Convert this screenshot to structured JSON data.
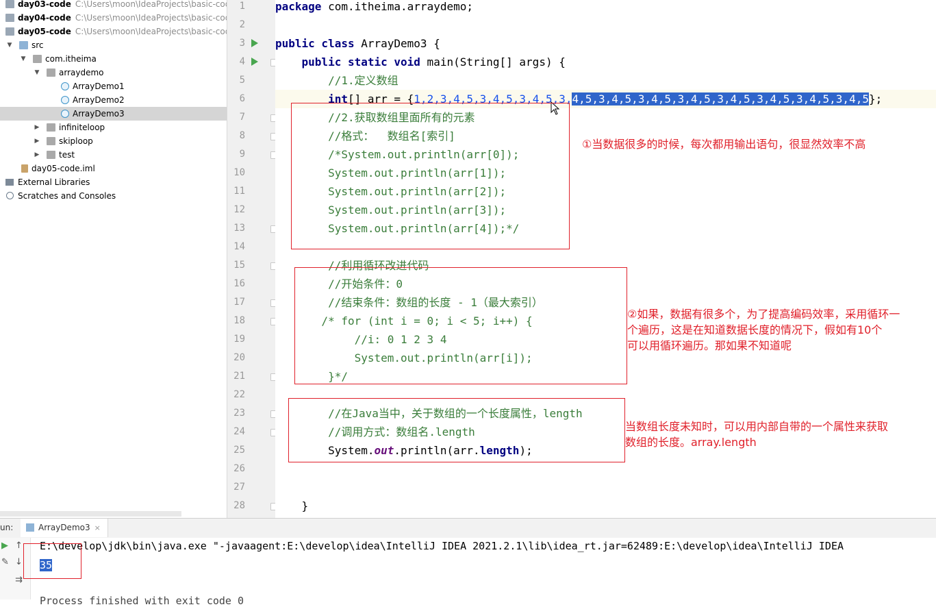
{
  "project": {
    "items": [
      {
        "label": "day03-code",
        "path": "C:\\Users\\moon\\IdeaProjects\\basic-code",
        "bold": true
      },
      {
        "label": "day04-code",
        "path": "C:\\Users\\moon\\IdeaProjects\\basic-code",
        "bold": true
      },
      {
        "label": "day05-code",
        "path": "C:\\Users\\moon\\IdeaProjects\\basic-code",
        "bold": true
      },
      {
        "label": "src"
      },
      {
        "label": "com.itheima"
      },
      {
        "label": "arraydemo"
      },
      {
        "label": "ArrayDemo1"
      },
      {
        "label": "ArrayDemo2"
      },
      {
        "label": "ArrayDemo3",
        "selected": true
      },
      {
        "label": "infiniteloop"
      },
      {
        "label": "skiploop"
      },
      {
        "label": "test"
      },
      {
        "label": "day05-code.iml"
      },
      {
        "label": "External Libraries"
      },
      {
        "label": "Scratches and Consoles"
      }
    ]
  },
  "gutter": {
    "line_numbers": [
      "1",
      "2",
      "3",
      "4",
      "5",
      "6",
      "7",
      "8",
      "9",
      "10",
      "11",
      "12",
      "13",
      "14",
      "15",
      "16",
      "17",
      "18",
      "19",
      "20",
      "21",
      "22",
      "23",
      "24",
      "25",
      "26",
      "27",
      "28"
    ]
  },
  "code": {
    "l1": {
      "kw": "package",
      "rest": " com.itheima.arraydemo;"
    },
    "l3": {
      "kw": "public class",
      "rest": " ArrayDemo3 {"
    },
    "l4": {
      "indent": "    ",
      "kw": "public static void",
      "rest": " main(String[] args) {"
    },
    "l5": "        //1.定义数组",
    "l6": {
      "indent": "        ",
      "kw": "int",
      "mid": "[] arr = {",
      "nums_plain": "1,2,3,4,5,3,4,5,3,4,5,3,",
      "nums_selected": "4,5,3,4,5,3,4,5,3,4,5,3,4,5,3,4,5,3,4,5,3,4,5",
      "end": "};"
    },
    "l7": "        //2.获取数组里面所有的元素",
    "l8": "        //格式：  数组名[索引]",
    "l9": "        /*System.out.println(arr[0]);",
    "l10": "        System.out.println(arr[1]);",
    "l11": "        System.out.println(arr[2]);",
    "l12": "        System.out.println(arr[3]);",
    "l13": "        System.out.println(arr[4]);*/",
    "l15": "        //利用循环改进代码",
    "l16": "        //开始条件：0",
    "l17": "        //结束条件：数组的长度 - 1（最大索引）",
    "l18": "       /* for (int i = 0; i < 5; i++) {",
    "l19": "            //i: 0 1 2 3 4",
    "l20": "            System.out.println(arr[i]);",
    "l21": "        }*/",
    "l23": "        //在Java当中，关于数组的一个长度属性，length",
    "l24": "        //调用方式：数组名.length",
    "l25": {
      "indent": "        ",
      "pre": "System.",
      "out": "out",
      "mid": ".println(arr.",
      "len": "length",
      "end": ");"
    },
    "l28": "    }"
  },
  "annotations": {
    "note1": "①当数据很多的时候，每次都用输出语句，很显然效率不高",
    "note2_line1": "②如果，数据有很多个，为了提高编码效率，采用循环一",
    "note2_line2": "个遍历，这是在知道数据长度的情况下，假如有10个",
    "note2_line3": "可以用循环遍历。那如果不知道呢",
    "note3_line1": "当数组长度未知时，可以用内部自带的一个属性来获取",
    "note3_line2": "数组的长度。array.length"
  },
  "run_panel": {
    "label": "un:",
    "tab": "ArrayDemo3",
    "close": "×",
    "console_line1": "E:\\develop\\jdk\\bin\\java.exe \"-javaagent:E:\\develop\\idea\\IntelliJ IDEA 2021.2.1\\lib\\idea_rt.jar=62489:E:\\develop\\idea\\IntelliJ IDEA",
    "console_line2": "35",
    "console_line3": "Process finished with exit code 0"
  },
  "colors": {
    "accent_red": "#e0202a",
    "selection": "#2f65ca",
    "keyword": "#000080",
    "comment": "#3a7d3a",
    "number": "#1750eb"
  }
}
